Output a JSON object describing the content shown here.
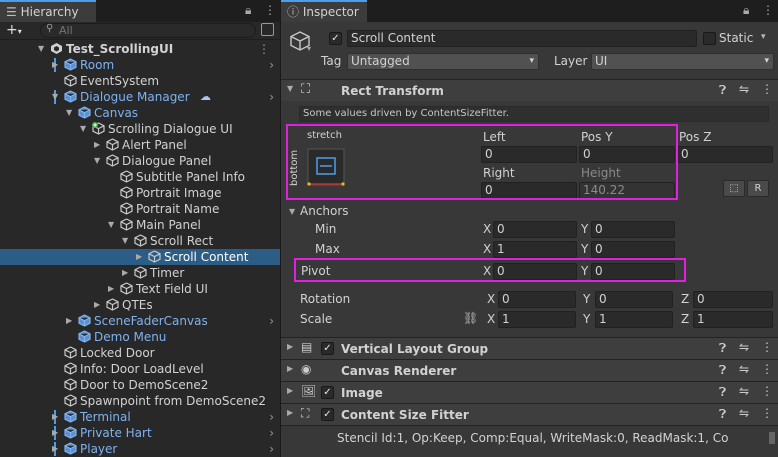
{
  "hierarchy": {
    "tab_title": "Hierarchy",
    "search_placeholder": "All",
    "add_label": "+",
    "rows": [
      {
        "label": "Test_ScrollingUI",
        "indent": 0,
        "expander": "down",
        "icon": "unity-scene",
        "blue": false,
        "bold": true,
        "chevron": false,
        "menu": true,
        "pbar": false
      },
      {
        "label": "Room",
        "indent": 1,
        "expander": "right",
        "icon": "cube",
        "blue": true,
        "chevron": true,
        "pbar": true
      },
      {
        "label": "EventSystem",
        "indent": 1,
        "expander": "",
        "icon": "cube",
        "blue": false,
        "chevron": false,
        "pbar": false
      },
      {
        "label": "Dialogue Manager",
        "indent": 1,
        "expander": "down",
        "icon": "cube",
        "blue": true,
        "chevron": true,
        "pbar": true,
        "cloud": true
      },
      {
        "label": "Canvas",
        "indent": 2,
        "expander": "down",
        "icon": "cube",
        "blue": true,
        "chevron": false,
        "pbar": false
      },
      {
        "label": "Scrolling Dialogue UI",
        "indent": 3,
        "expander": "down",
        "icon": "cube-added",
        "blue": false,
        "chevron": false,
        "pbar": false
      },
      {
        "label": "Alert Panel",
        "indent": 4,
        "expander": "right",
        "icon": "cube",
        "blue": false,
        "chevron": false,
        "pbar": false
      },
      {
        "label": "Dialogue Panel",
        "indent": 4,
        "expander": "down",
        "icon": "cube",
        "blue": false,
        "chevron": false,
        "pbar": false
      },
      {
        "label": "Subtitle Panel Info",
        "indent": 5,
        "expander": "",
        "icon": "cube",
        "blue": false,
        "chevron": false,
        "pbar": false
      },
      {
        "label": "Portrait Image",
        "indent": 5,
        "expander": "",
        "icon": "cube",
        "blue": false,
        "chevron": false,
        "pbar": false
      },
      {
        "label": "Portrait Name",
        "indent": 5,
        "expander": "",
        "icon": "cube",
        "blue": false,
        "chevron": false,
        "pbar": false
      },
      {
        "label": "Main Panel",
        "indent": 5,
        "expander": "down",
        "icon": "cube",
        "blue": false,
        "chevron": false,
        "pbar": false
      },
      {
        "label": "Scroll Rect",
        "indent": 6,
        "expander": "down",
        "icon": "cube",
        "blue": false,
        "chevron": false,
        "pbar": false
      },
      {
        "label": "Scroll Content",
        "indent": 7,
        "expander": "right",
        "icon": "cube",
        "blue": false,
        "chevron": false,
        "pbar": false,
        "selected": true
      },
      {
        "label": "Timer",
        "indent": 6,
        "expander": "right",
        "icon": "cube",
        "blue": false,
        "chevron": false,
        "pbar": false
      },
      {
        "label": "Text Field UI",
        "indent": 5,
        "expander": "right",
        "icon": "cube",
        "blue": false,
        "chevron": false,
        "pbar": false
      },
      {
        "label": "QTEs",
        "indent": 4,
        "expander": "right",
        "icon": "cube",
        "blue": false,
        "chevron": false,
        "pbar": false
      },
      {
        "label": "SceneFaderCanvas",
        "indent": 2,
        "expander": "right",
        "icon": "cube",
        "blue": true,
        "chevron": true,
        "pbar": false
      },
      {
        "label": "Demo Menu",
        "indent": 2,
        "expander": "",
        "icon": "cube",
        "blue": true,
        "chevron": false,
        "pbar": false
      },
      {
        "label": "Locked Door",
        "indent": 1,
        "expander": "",
        "icon": "cube",
        "blue": false,
        "chevron": false,
        "pbar": false
      },
      {
        "label": "Info: Door LoadLevel",
        "indent": 1,
        "expander": "",
        "icon": "cube",
        "blue": false,
        "chevron": false,
        "pbar": false
      },
      {
        "label": "Door to DemoScene2",
        "indent": 1,
        "expander": "",
        "icon": "cube",
        "blue": false,
        "chevron": false,
        "pbar": false
      },
      {
        "label": "Spawnpoint from DemoScene2",
        "indent": 1,
        "expander": "",
        "icon": "cube",
        "blue": false,
        "chevron": false,
        "pbar": false
      },
      {
        "label": "Terminal",
        "indent": 1,
        "expander": "right",
        "icon": "cube",
        "blue": true,
        "chevron": true,
        "pbar": true
      },
      {
        "label": "Private Hart",
        "indent": 1,
        "expander": "right",
        "icon": "cube",
        "blue": true,
        "chevron": true,
        "pbar": true
      },
      {
        "label": "Player",
        "indent": 1,
        "expander": "right",
        "icon": "cube",
        "blue": true,
        "chevron": true,
        "pbar": true
      }
    ]
  },
  "inspector": {
    "tab_title": "Inspector",
    "object_name": "Scroll Content",
    "static_label": "Static",
    "tag_label": "Tag",
    "tag_value": "Untagged",
    "layer_label": "Layer",
    "layer_value": "UI",
    "rect_transform": {
      "title": "Rect Transform",
      "driven_note": "Some values driven by ContentSizeFitter.",
      "anchor_h": "stretch",
      "anchor_v": "bottom",
      "left_label": "Left",
      "left_value": "0",
      "posy_label": "Pos Y",
      "posy_value": "0",
      "posz_label": "Pos Z",
      "posz_value": "0",
      "right_label": "Right",
      "right_value": "0",
      "height_label": "Height",
      "height_value": "140.22",
      "r_button": "R",
      "anchors_label": "Anchors",
      "min_label": "Min",
      "min_x": "0",
      "min_y": "0",
      "max_label": "Max",
      "max_x": "1",
      "max_y": "0",
      "pivot_label": "Pivot",
      "pivot_x": "0",
      "pivot_y": "0",
      "rotation_label": "Rotation",
      "rot_x": "0",
      "rot_y": "0",
      "rot_z": "0",
      "scale_label": "Scale",
      "scale_x": "1",
      "scale_y": "1",
      "scale_z": "1",
      "x": "X",
      "y": "Y",
      "z": "Z"
    },
    "components": [
      {
        "title": "Vertical Layout Group",
        "icon": "layout-icon",
        "check": true
      },
      {
        "title": "Canvas Renderer",
        "icon": "eye-icon",
        "check": false
      },
      {
        "title": "Image",
        "icon": "image-icon",
        "check": true
      },
      {
        "title": "Content Size Fitter",
        "icon": "fitter-icon",
        "check": true
      }
    ],
    "stencil_text": "Stencil Id:1, Op:Keep, Comp:Equal, WriteMask:0, ReadMask:1, Co"
  },
  "colors": {
    "accent": "#4c9ee8",
    "selection": "#2c5d87",
    "prefab_blue": "#7fb2ef",
    "highlight": "#e020e0"
  }
}
